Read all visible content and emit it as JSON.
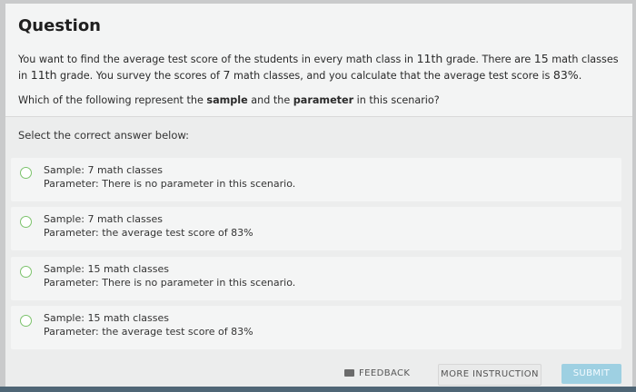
{
  "question": {
    "title": "Question",
    "text_a": "You want to find the average test score of the students in every math class in ",
    "grade1": "11th",
    "text_b": " grade. There are ",
    "classes_total": "15",
    "text_c": " math classes in ",
    "grade2": "11th",
    "text_d": " grade. You survey the scores of ",
    "classes_sampled": "7",
    "text_e": " math classes, and you calculate that the average test score is ",
    "avg_score": "83%",
    "text_f": ".",
    "ask_a": "Which of the following represent the ",
    "ask_sample": "sample",
    "ask_b": " and the ",
    "ask_parameter": "parameter",
    "ask_c": " in this scenario?"
  },
  "select_label": "Select the correct answer below:",
  "options": [
    {
      "line1": "Sample: 7 math classes",
      "line2": "Parameter: There is no parameter in this scenario."
    },
    {
      "line1": "Sample: 7 math classes",
      "line2": "Parameter: the average test score of 83%"
    },
    {
      "line1": "Sample: 15 math classes",
      "line2": "Parameter: There is no parameter in this scenario."
    },
    {
      "line1": "Sample: 15 math classes",
      "line2": "Parameter: the average test score of 83%"
    }
  ],
  "footer": {
    "feedback": "FEEDBACK",
    "more_instruction": "MORE INSTRUCTION",
    "submit": "SUBMIT"
  },
  "colors": {
    "radio_border": "#7cc36c",
    "submit_bg": "#9ed0e2"
  }
}
